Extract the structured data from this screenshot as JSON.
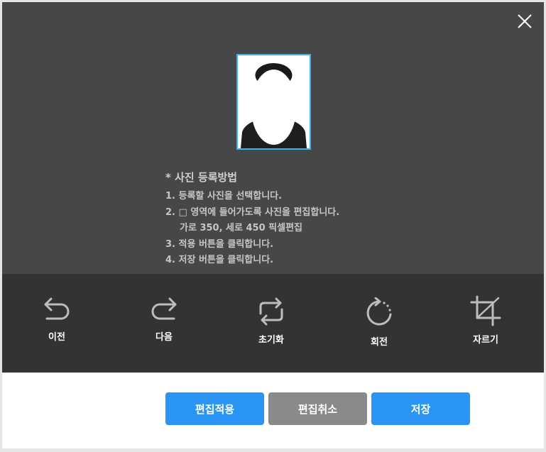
{
  "instructions": {
    "title": "* 사진 등록방법",
    "steps": [
      "1. 등록할 사진을 선택합니다.",
      "2. □ 영역에 들어가도록 사진을 편집합니다.",
      "가로 350, 세로 450 픽셀편집",
      "3. 적용 버튼을 클릭합니다.",
      "4. 저장 버튼을 클릭합니다."
    ]
  },
  "toolbar": {
    "undo_label": "이전",
    "redo_label": "다음",
    "reset_label": "초기화",
    "rotate_label": "회전",
    "crop_label": "자르기"
  },
  "buttons": {
    "apply_label": "편집적용",
    "cancel_label": "편집취소",
    "save_label": "저장"
  },
  "colors": {
    "preview_bg": "#474747",
    "toolbar_bg": "#333333",
    "primary": "#2b95f5",
    "secondary": "#8a8a8a",
    "frame_border": "#3fb2e6"
  },
  "icons": [
    "close-icon",
    "undo-icon",
    "redo-icon",
    "reset-icon",
    "rotate-icon",
    "crop-icon"
  ]
}
